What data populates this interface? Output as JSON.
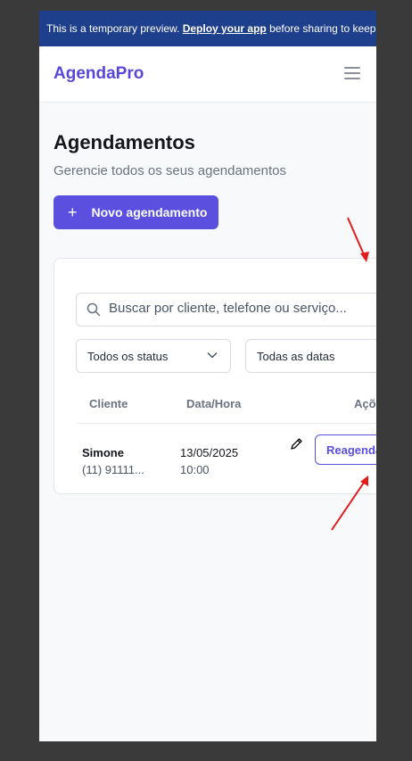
{
  "banner": {
    "text_before": "This is a temporary preview. ",
    "link": "Deploy your app",
    "text_after": " before sharing to keep it l"
  },
  "header": {
    "brand": "AgendaPro",
    "menu_icon": "hamburger-icon"
  },
  "page": {
    "title": "Agendamentos",
    "subtitle": "Gerencie todos os seus agendamentos",
    "new_button": {
      "icon": "plus-icon",
      "label": "Novo agendamento"
    }
  },
  "filters": {
    "search_placeholder": "Buscar por cliente, telefone ou serviço...",
    "status_select": "Todos os status",
    "date_select": "Todas as datas"
  },
  "table": {
    "columns": [
      "Cliente",
      "Data/Hora",
      "Açõ"
    ],
    "rows": [
      {
        "name": "Simone",
        "phone": "(11) 91111...",
        "date": "13/05/2025",
        "time": "10:00",
        "action": "Reagenda"
      }
    ]
  },
  "colors": {
    "accent": "#5b4fe0",
    "banner": "#1e3f8c",
    "annotation": "#e21c1c"
  }
}
